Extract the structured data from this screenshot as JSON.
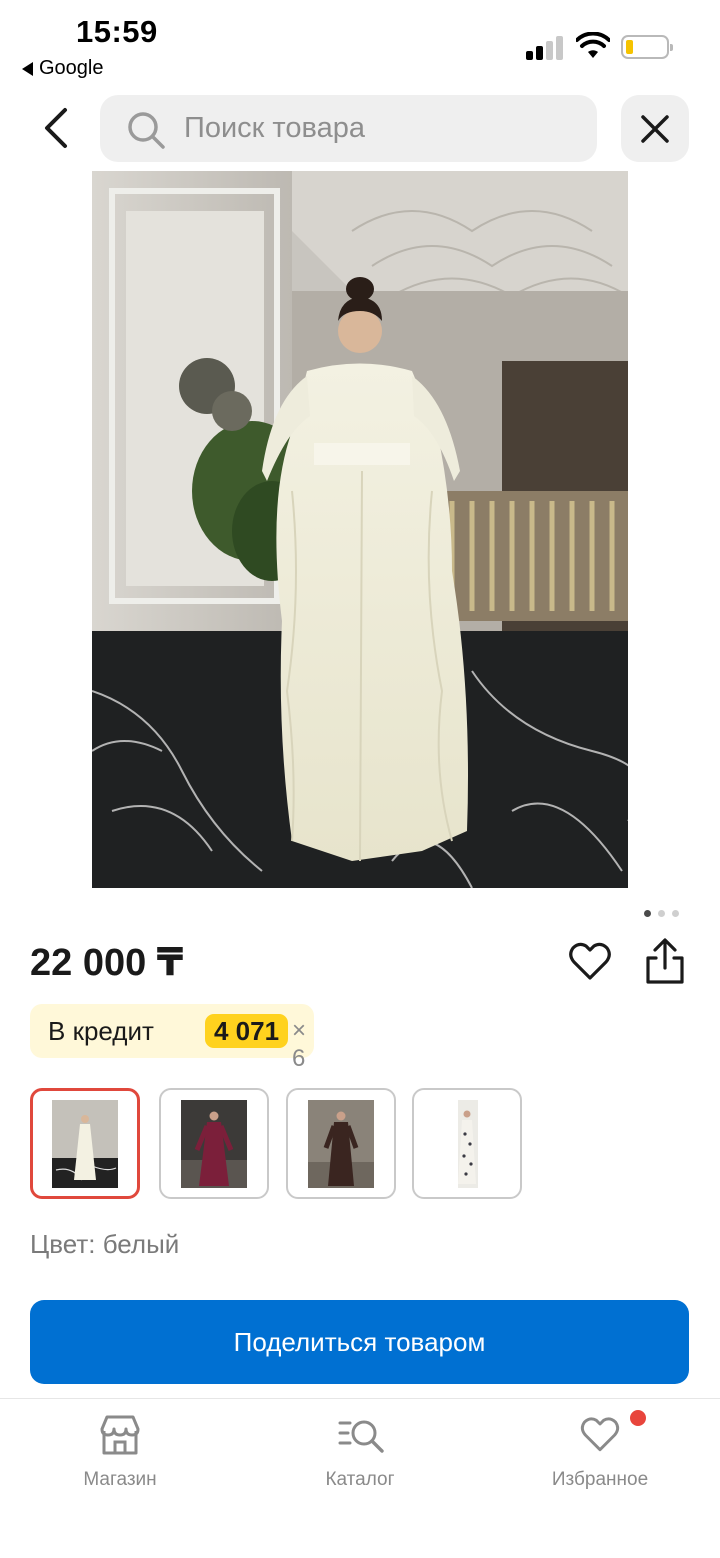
{
  "status_bar": {
    "time": "15:59",
    "back_app": "Google"
  },
  "header": {
    "search_placeholder": "Поиск товара",
    "back_icon": "chevron-left-icon",
    "close_icon": "close-icon"
  },
  "gallery": {
    "image_count": 3,
    "active_index": 0
  },
  "product": {
    "price": "22 000 ₸",
    "credit": {
      "label": "В кредит",
      "amount": "4 071",
      "times": "× 6"
    },
    "variants": [
      {
        "color": "white",
        "selected": true
      },
      {
        "color": "burgundy",
        "selected": false
      },
      {
        "color": "dark-brown",
        "selected": false
      },
      {
        "color": "floral-print",
        "selected": false
      }
    ],
    "color_label": "Цвет: белый"
  },
  "actions": {
    "share_button": "Поделиться товаром"
  },
  "bottom_nav": {
    "items": [
      {
        "label": "Магазин",
        "icon": "store-icon"
      },
      {
        "label": "Каталог",
        "icon": "catalog-search-icon"
      },
      {
        "label": "Избранное",
        "icon": "heart-icon"
      }
    ],
    "favorites_badge": true
  },
  "colors": {
    "primary": "#0070d2",
    "credit_bg": "#fff8d9",
    "credit_amount_bg": "#ffd21e",
    "selected_border": "#e0483c",
    "badge": "#e8453c"
  }
}
